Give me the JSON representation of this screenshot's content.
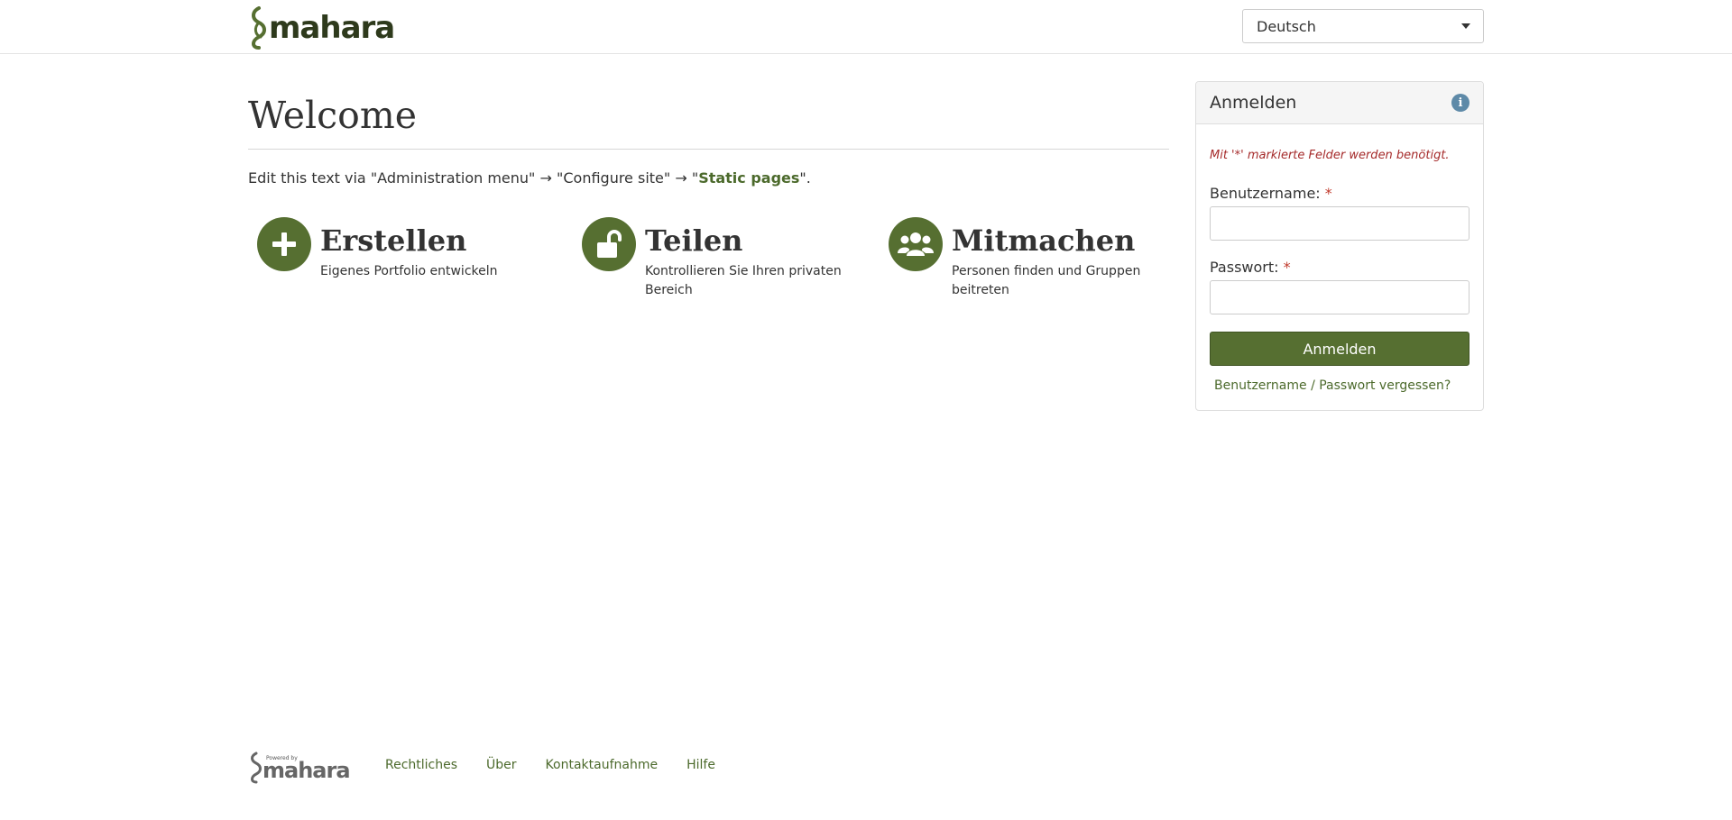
{
  "header": {
    "logo_text": "mahara",
    "language": {
      "selected": "Deutsch"
    }
  },
  "main": {
    "title": "Welcome",
    "intro": {
      "prefix": "Edit this text via \"Administration menu\" → \"Configure site\" → \"",
      "link": "Static pages",
      "suffix": "\"."
    },
    "features": [
      {
        "icon": "plus-icon",
        "title": "Erstellen",
        "description": "Eigenes Portfolio entwickeln"
      },
      {
        "icon": "unlock-icon",
        "title": "Teilen",
        "description": "Kontrollieren Sie Ihren privaten Bereich"
      },
      {
        "icon": "users-icon",
        "title": "Mitmachen",
        "description": "Personen finden und Gruppen beitreten"
      }
    ]
  },
  "login": {
    "title": "Anmelden",
    "required_note": "Mit '*' markierte Felder werden benötigt.",
    "username_label": "Benutzername:",
    "password_label": "Passwort:",
    "required_star": "*",
    "username_value": "",
    "password_value": "",
    "submit_label": "Anmelden",
    "forgot_link": "Benutzername / Passwort vergessen?"
  },
  "footer": {
    "powered_by": "Powered by",
    "brand": "mahara",
    "links": [
      "Rechtliches",
      "Über",
      "Kontaktaufnahme",
      "Hilfe"
    ]
  },
  "colors": {
    "brand_green": "#566f31",
    "link_green": "#4c6a2c",
    "required_red": "#a52a2a",
    "info_blue": "#5e8aa8"
  }
}
